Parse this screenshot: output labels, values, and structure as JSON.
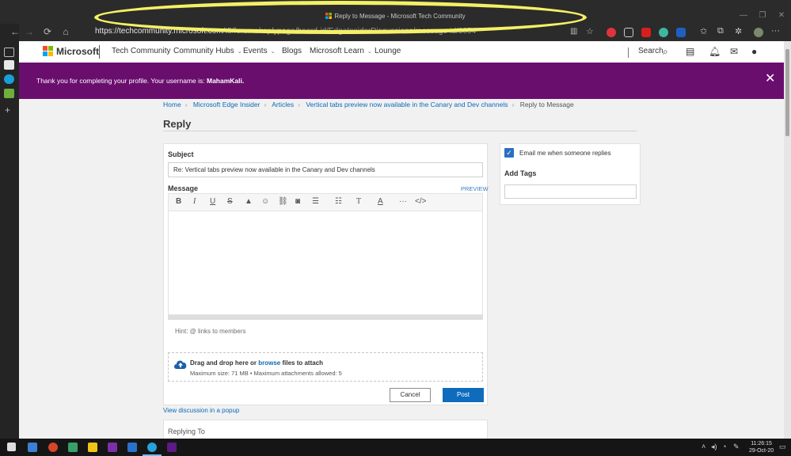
{
  "window": {
    "title": "Reply to Message - Microsoft Tech Community",
    "controls": [
      "—",
      "❐",
      "✕"
    ]
  },
  "browser": {
    "url_host": "https://techcommunity.microsoft.com",
    "url_path": "/t5/forums/replypage/board-id/EdgeInsiderDiscussions/message-id/8054"
  },
  "site": {
    "brand": "Microsoft",
    "product": "Tech Community",
    "nav": [
      "Community Hubs",
      "Events",
      "Blogs",
      "Microsoft Learn",
      "Lounge"
    ],
    "search_label": "Search"
  },
  "banner": {
    "text": "Thank you for completing your profile. Your username is: ",
    "username": "MahamKali."
  },
  "breadcrumbs": [
    "Home",
    "Microsoft Edge Insider",
    "Articles",
    "Vertical tabs preview now available in the Canary and Dev channels",
    "Reply to Message"
  ],
  "reply_form": {
    "heading": "Reply",
    "subject_label": "Subject",
    "subject_value": "Re: Vertical tabs preview now available in the Canary and Dev channels",
    "message_label": "Message",
    "preview_label": "PREVIEW",
    "hint": "Hint:  @ links to members",
    "drop_text_pre": "Drag and drop here or ",
    "drop_link": "browse",
    "drop_text_post": " files to attach",
    "drop_limits": "Maximum size: 71 MB • Maximum attachments allowed: 5",
    "cancel_label": "Cancel",
    "post_label": "Post",
    "popup_link": "View discussion in a popup",
    "replying_to": "Replying To"
  },
  "sidebar": {
    "email_checkbox_label": "Email me when someone replies",
    "email_checked": true,
    "tags_label": "Add Tags"
  },
  "taskbar": {
    "time": "11:26:15",
    "date": "29-Oct-20"
  },
  "colors": {
    "banner": "#6a0e6e",
    "accent": "#0f6cbd",
    "highlight": "#f4f066"
  }
}
